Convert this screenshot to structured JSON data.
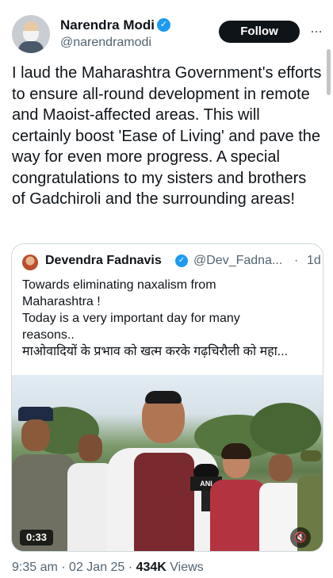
{
  "author": {
    "name": "Narendra Modi",
    "handle": "@narendramodi",
    "verified_icon": "verified-badge-icon"
  },
  "actions": {
    "follow_label": "Follow",
    "more_label": "···"
  },
  "tweet": {
    "text": "I laud the Maharashtra Government's efforts to ensure all-round development in remote and Maoist-affected areas. This will certainly boost 'Ease of Living' and pave the way for even more progress. A special congratulations to my sisters and brothers of Gadchiroli and the surrounding areas!"
  },
  "quote": {
    "name": "Devendra Fadnavis",
    "handle": "@Dev_Fadna...",
    "separator": "·",
    "time": "1d",
    "lines": [
      "Towards eliminating naxalism from",
      "Maharashtra !",
      "Today is a very important day for many",
      "reasons..",
      "माओवादियों के प्रभाव को खत्म करके गढ़चिरौली को महा..."
    ],
    "video": {
      "duration": "0:33",
      "mic_label": "ANI",
      "mute_icon": "muted-speaker-icon"
    }
  },
  "meta": {
    "time": "9:35 am",
    "sep1": "·",
    "date": "02 Jan 25",
    "sep2": "·",
    "views_count": "434K",
    "views_label": "Views"
  }
}
